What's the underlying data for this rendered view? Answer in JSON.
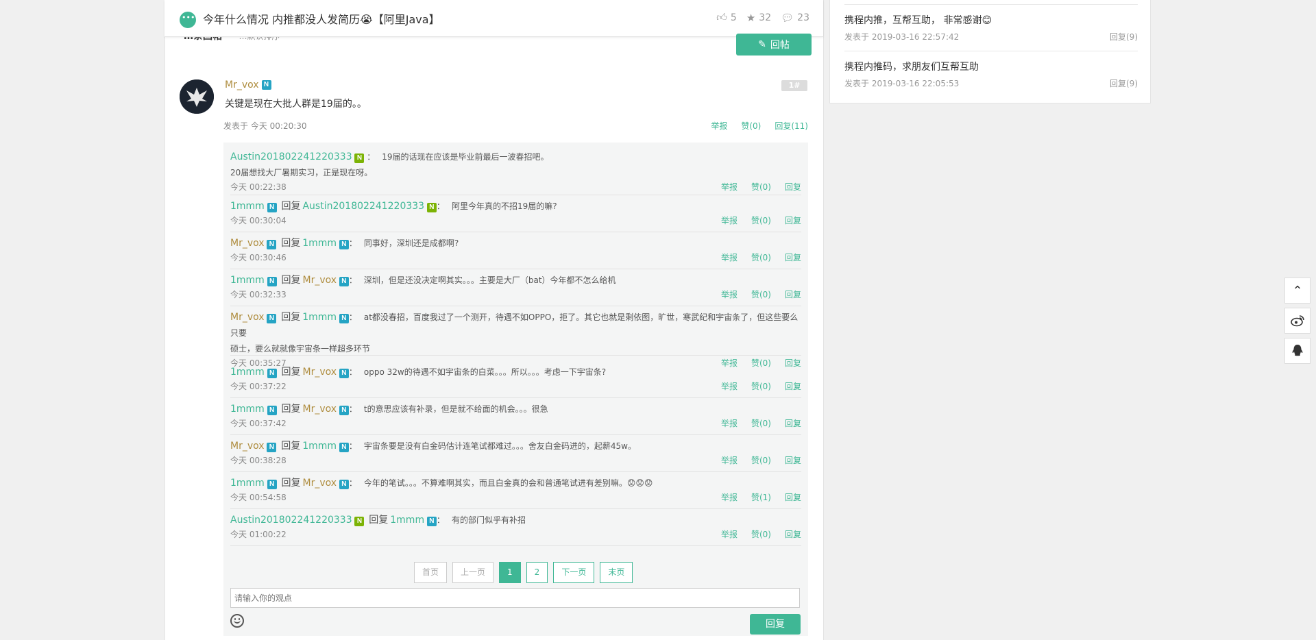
{
  "topbar": {
    "title": "今年什么情况 内推都没人发简历😭【阿里Java】",
    "likes": "5",
    "stars": "32",
    "comments": "23"
  },
  "sort": {
    "label": "…条回帖",
    "order": "…默认排序"
  },
  "reply_post_button": "回帖",
  "floor": {
    "author": "Mr_vox",
    "badge": "N",
    "number": "1#",
    "content": "关键是现在大批人群是19届的。。",
    "time": "发表于 今天 00:20:30",
    "report": "举报",
    "like": "赞(0)",
    "reply": "回复(11)"
  },
  "replies": [
    {
      "user": "Austin201802241220333",
      "user_color": "green",
      "badge": "green",
      "to": "",
      "to_color": "",
      "text": "19届的话现在应该是毕业前最后一波春招吧。",
      "text2": "20届想找大厂暑期实习，正是现在呀。",
      "time": "今天 00:22:38",
      "like": "赞(0)"
    },
    {
      "user": "1mmm",
      "user_color": "green",
      "badge": "blue",
      "to": "Austin201802241220333",
      "to_color": "green",
      "to_badge": "green",
      "text": "阿里今年真的不招19届的嘛?",
      "time": "今天 00:30:04",
      "like": "赞(0)"
    },
    {
      "user": "Mr_vox",
      "user_color": "gold",
      "badge": "blue",
      "to": "1mmm",
      "to_color": "green",
      "to_badge": "blue",
      "text": "同事好，深圳还是成都啊?",
      "time": "今天 00:30:46",
      "like": "赞(0)"
    },
    {
      "user": "1mmm",
      "user_color": "green",
      "badge": "blue",
      "to": "Mr_vox",
      "to_color": "gold",
      "to_badge": "blue",
      "text": "深圳，但是还没决定啊其实。。。主要是大厂（bat）今年都不怎么给机",
      "time": "今天 00:32:33",
      "like": "赞(0)"
    },
    {
      "user": "Mr_vox",
      "user_color": "gold",
      "badge": "blue",
      "to": "1mmm",
      "to_color": "green",
      "to_badge": "blue",
      "text": "at都没春招，百度我过了一个测开，待遇不如OPPO，拒了。其它也就是剩依图，旷世，寒武纪和宇宙条了，但这些要么只要",
      "text2": "硕士，要么就就像宇宙条一样超多环节",
      "time": "今天 00:35:27",
      "like": "赞(0)"
    },
    {
      "user": "1mmm",
      "user_color": "green",
      "badge": "blue",
      "to": "Mr_vox",
      "to_color": "gold",
      "to_badge": "blue",
      "text": "oppo 32w的待遇不如宇宙条的白菜。。。所以。。。考虑一下宇宙条?",
      "time": "今天 00:37:22",
      "like": "赞(0)"
    },
    {
      "user": "1mmm",
      "user_color": "green",
      "badge": "blue",
      "to": "Mr_vox",
      "to_color": "gold",
      "to_badge": "blue",
      "text": "t的意思应该有补录，但是就不给面的机会。。。很急",
      "time": "今天 00:37:42",
      "like": "赞(0)"
    },
    {
      "user": "Mr_vox",
      "user_color": "gold",
      "badge": "blue",
      "to": "1mmm",
      "to_color": "green",
      "to_badge": "blue",
      "text": "宇宙条要是没有白金码估计连笔试都难过。。。舍友白金码进的，起薪45w。",
      "time": "今天 00:38:28",
      "like": "赞(0)"
    },
    {
      "user": "1mmm",
      "user_color": "green",
      "badge": "blue",
      "to": "Mr_vox",
      "to_color": "gold",
      "to_badge": "blue",
      "text": "今年的笔试。。。不算难啊其实，而且白金真的会和普通笔试进有差别嘛。😟😟😟",
      "time": "今天 00:54:58",
      "like": "赞(1)"
    },
    {
      "user": "Austin201802241220333",
      "user_color": "green",
      "badge": "green",
      "to": "1mmm",
      "to_color": "green",
      "to_badge": "blue",
      "text": "有的部门似乎有补招",
      "time": "今天 01:00:22",
      "like": "赞(0)"
    }
  ],
  "reply_labels": {
    "reply_word": "回复",
    "report": "举报",
    "reply": "回复"
  },
  "pager": {
    "first": "首页",
    "prev": "上一页",
    "p1": "1",
    "p2": "2",
    "next": "下一页",
    "last": "末页"
  },
  "comment": {
    "placeholder": "请输入你的观点",
    "submit": "回复"
  },
  "sidebar": [
    {
      "title": "携程内推，互帮互助， 非常感谢😊",
      "time": "发表于 2019-03-16 22:57:42",
      "replies": "回复(9)"
    },
    {
      "title": "携程内推码，求朋友们互帮互助",
      "time": "发表于 2019-03-16 22:05:53",
      "replies": "回复(9)"
    }
  ],
  "colors": {
    "accent": "#3fb795",
    "gold": "#ae8c3d",
    "badge_blue": "#25a4c4",
    "badge_green": "#7cb305"
  }
}
